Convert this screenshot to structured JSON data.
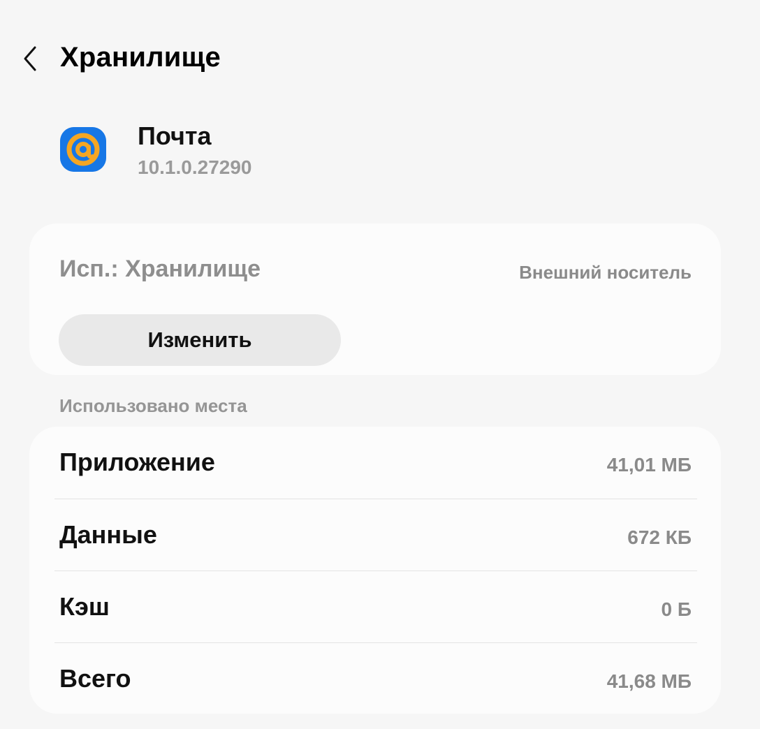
{
  "header": {
    "back_icon": "chevron-left-icon",
    "title": "Хранилище"
  },
  "app": {
    "icon": "at-sign-icon",
    "name": "Почта",
    "version": "10.1.0.27290",
    "icon_colors": {
      "background": "#1777e6",
      "ring": "#f5a623"
    }
  },
  "storage_location": {
    "label": "Исп.: Хранилище",
    "value": "Внешний носитель",
    "change_button": "Изменить"
  },
  "space_used": {
    "section_title": "Использовано места",
    "rows": [
      {
        "label": "Приложение",
        "value": "41,01 МБ"
      },
      {
        "label": "Данные",
        "value": "672 КБ"
      },
      {
        "label": "Кэш",
        "value": "0 Б"
      },
      {
        "label": "Всего",
        "value": "41,68 МБ"
      }
    ]
  }
}
